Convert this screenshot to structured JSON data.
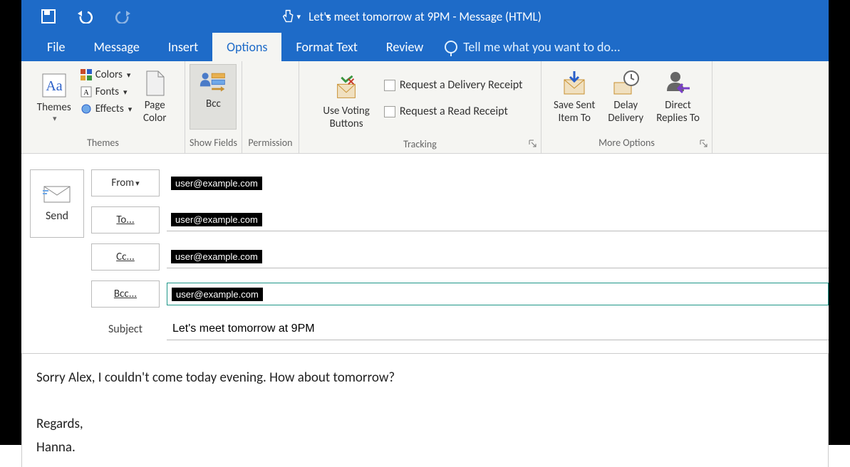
{
  "title": "Let's meet tomorrow at 9PM - Message (HTML)",
  "tabs": {
    "file": "File",
    "message": "Message",
    "insert": "Insert",
    "options": "Options",
    "format": "Format Text",
    "review": "Review",
    "tellme": "Tell me what you want to do..."
  },
  "ribbon": {
    "themes": {
      "themes_btn": "Themes",
      "colors": "Colors",
      "fonts": "Fonts",
      "effects": "Effects",
      "page_color": "Page\nColor",
      "group_label": "Themes"
    },
    "show_fields": {
      "bcc": "Bcc",
      "group_label": "Show Fields"
    },
    "permission": {
      "group_label": "Permission"
    },
    "tracking": {
      "voting": "Use Voting\nButtons",
      "delivery": "Request a Delivery Receipt",
      "read": "Request a Read Receipt",
      "group_label": "Tracking"
    },
    "more": {
      "save_sent": "Save Sent\nItem To",
      "delay": "Delay\nDelivery",
      "direct": "Direct\nReplies To",
      "group_label": "More Options"
    }
  },
  "compose": {
    "send": "Send",
    "from_btn": "From",
    "from_value": "user@example.com",
    "to_btn": "To...",
    "to_value": "user@example.com",
    "cc_btn": "Cc...",
    "cc_value": "user@example.com",
    "bcc_btn": "Bcc...",
    "bcc_value": "user@example.com",
    "subject_label": "Subject",
    "subject_value": "Let's meet tomorrow at 9PM"
  },
  "body": {
    "line1": "Sorry Alex, I couldn't come today evening. How about tomorrow?",
    "line2": "Regards,",
    "line3": "Hanna."
  }
}
